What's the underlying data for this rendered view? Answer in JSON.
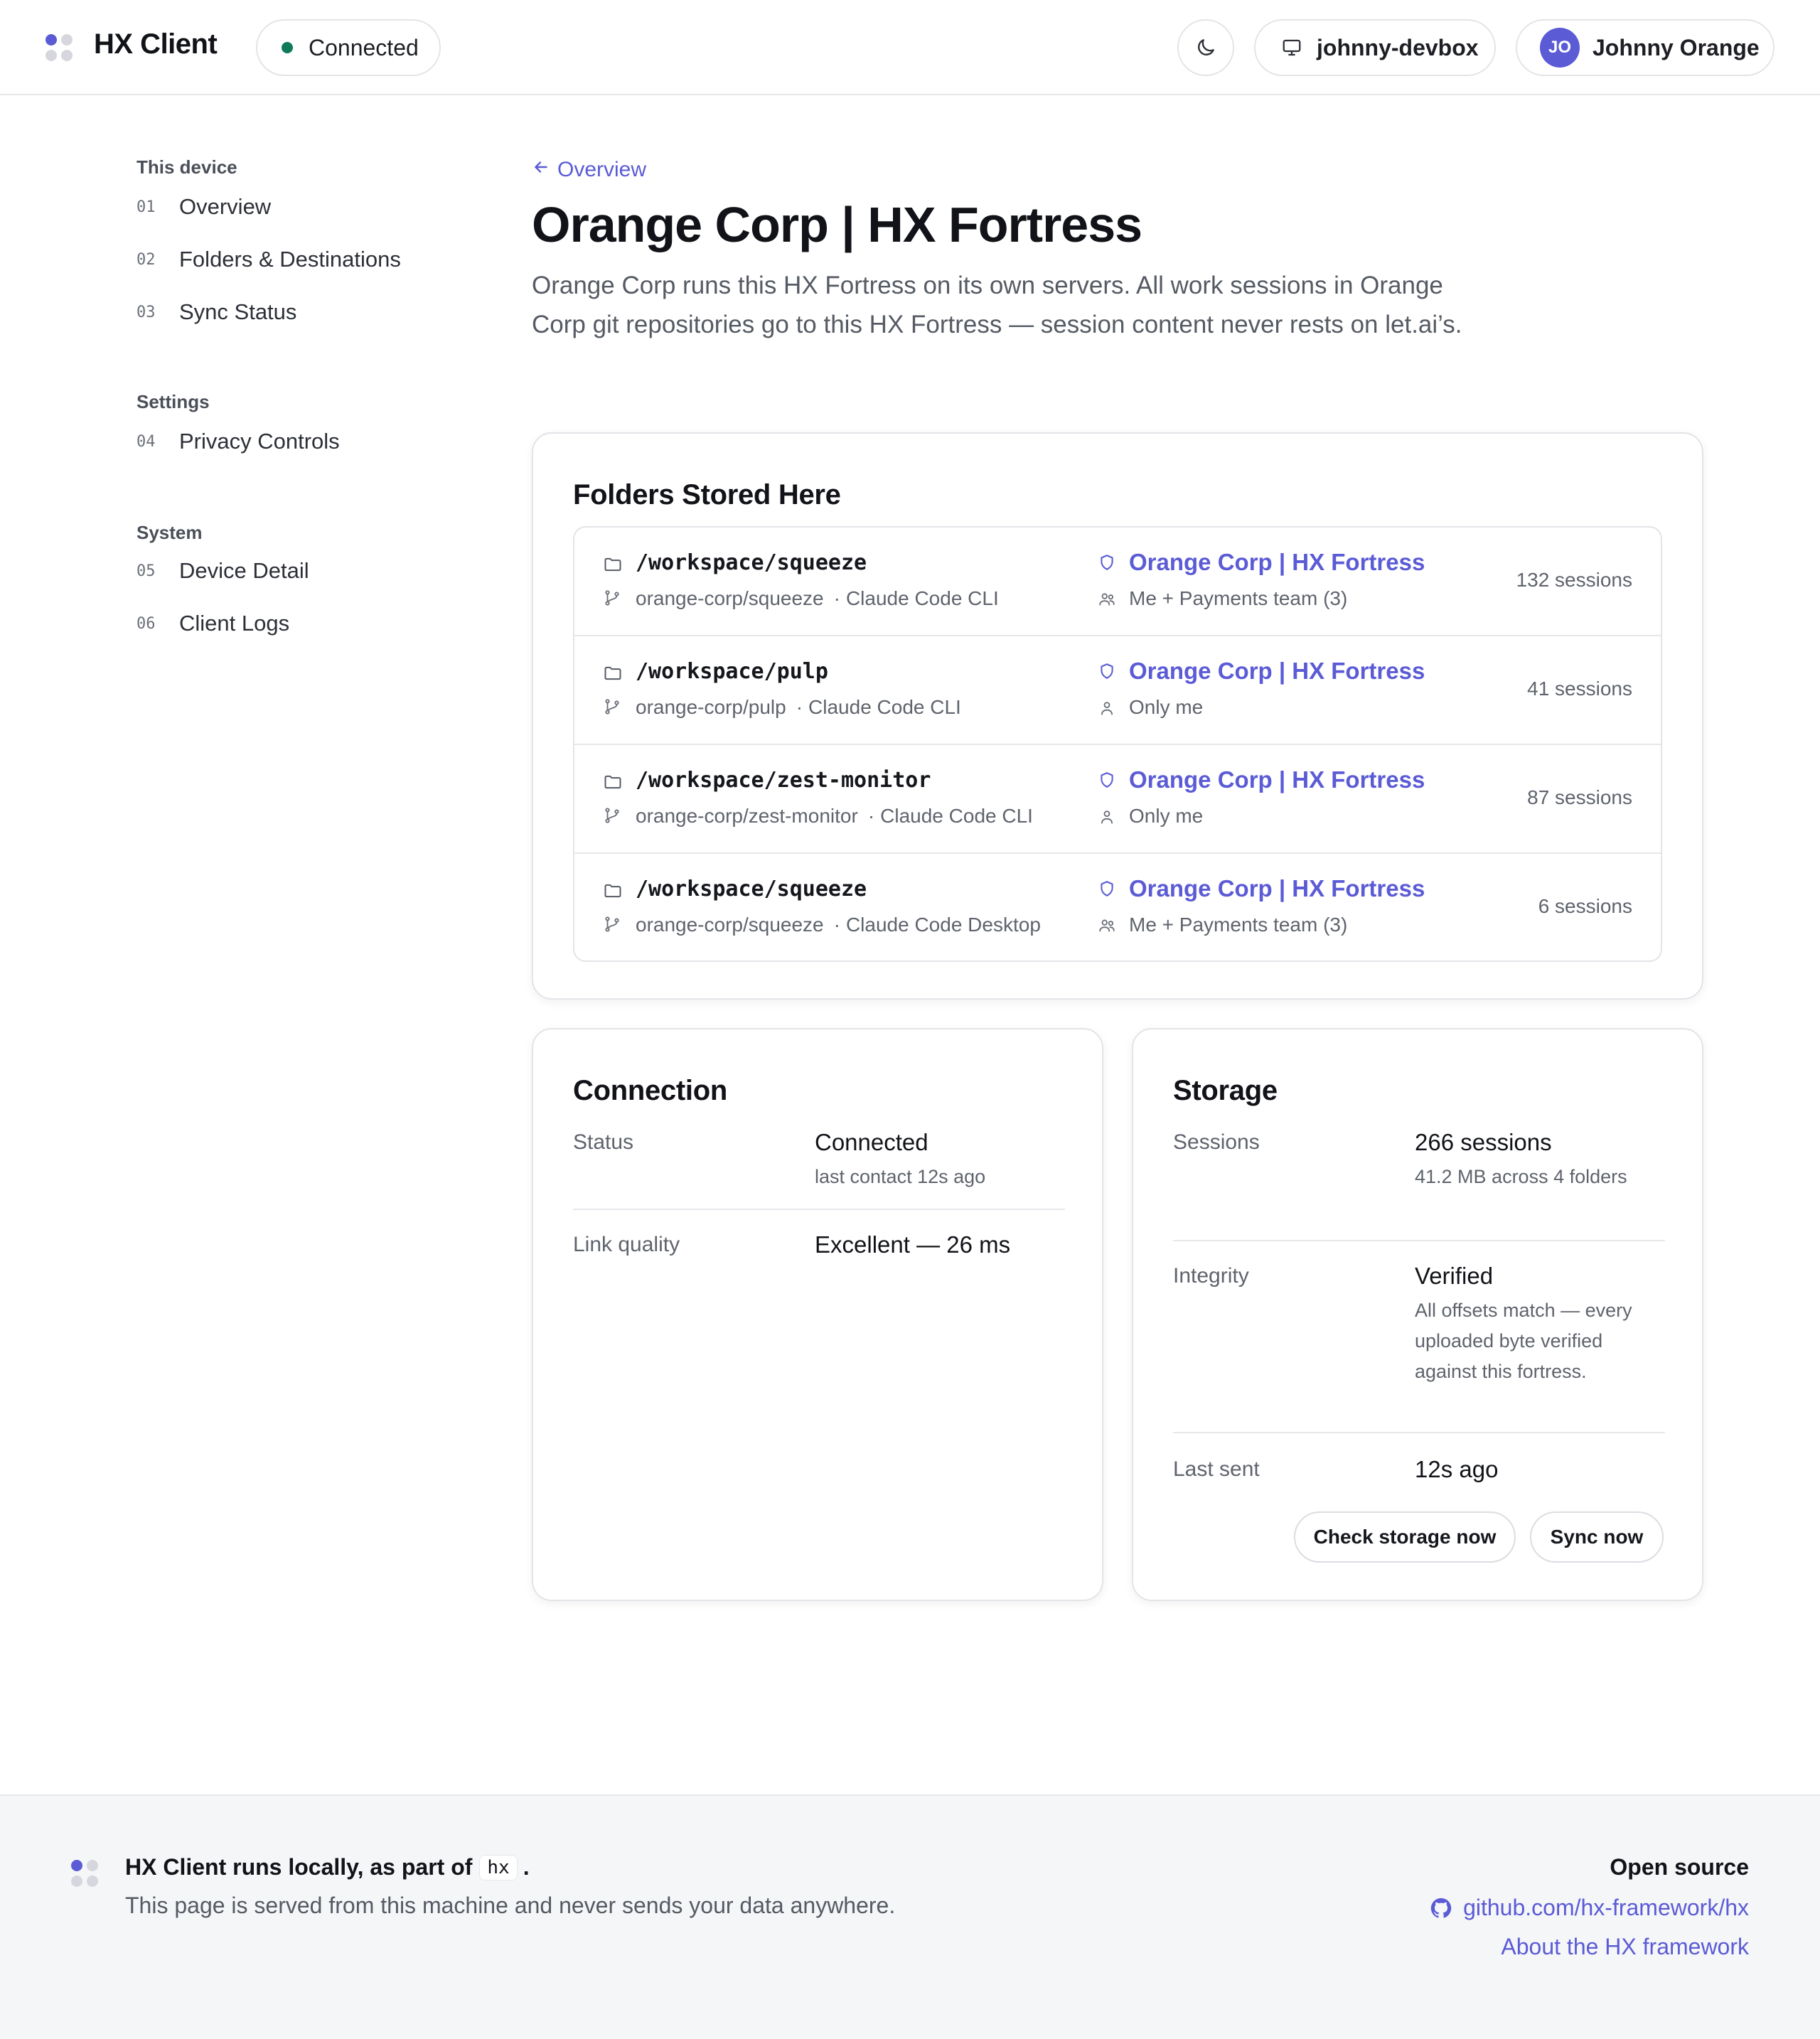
{
  "header": {
    "brand": "HX Client",
    "status": "Connected",
    "device": "johnny-devbox",
    "user_initials": "JO",
    "user_name": "Johnny Orange",
    "accent_color": "#5b5bd6",
    "status_color": "#0f7a5a"
  },
  "sidebar": {
    "sections": [
      {
        "title": "This device",
        "items": [
          {
            "num": "01",
            "label": "Overview"
          },
          {
            "num": "02",
            "label": "Folders & Destinations"
          },
          {
            "num": "03",
            "label": "Sync Status"
          }
        ]
      },
      {
        "title": "Settings",
        "items": [
          {
            "num": "04",
            "label": "Privacy Controls"
          }
        ]
      },
      {
        "title": "System",
        "items": [
          {
            "num": "05",
            "label": "Device Detail"
          },
          {
            "num": "06",
            "label": "Client Logs"
          }
        ]
      }
    ]
  },
  "main": {
    "back_label": "Overview",
    "title": "Orange Corp | HX Fortress",
    "description": "Orange Corp runs this HX Fortress on its own servers. All work sessions in Orange Corp git repositories go to this HX Fortress — session content never rests on let.ai’s."
  },
  "folders": {
    "title": "Folders Stored Here",
    "rows": [
      {
        "path": "/workspace/squeeze",
        "repo": "orange-corp/squeeze",
        "tool": "Claude Code CLI",
        "destination": "Orange Corp | HX Fortress",
        "access": "Me + Payments team (3)",
        "access_icon": "people-icon",
        "sessions": "132 sessions"
      },
      {
        "path": "/workspace/pulp",
        "repo": "orange-corp/pulp",
        "tool": "Claude Code CLI",
        "destination": "Orange Corp | HX Fortress",
        "access": "Only me",
        "access_icon": "person-icon",
        "sessions": "41 sessions"
      },
      {
        "path": "/workspace/zest-monitor",
        "repo": "orange-corp/zest-monitor",
        "tool": "Claude Code CLI",
        "destination": "Orange Corp | HX Fortress",
        "access": "Only me",
        "access_icon": "person-icon",
        "sessions": "87 sessions"
      },
      {
        "path": "/workspace/squeeze",
        "repo": "orange-corp/squeeze",
        "tool": "Claude Code Desktop",
        "destination": "Orange Corp | HX Fortress",
        "access": "Me + Payments team (3)",
        "access_icon": "people-icon",
        "sessions": "6 sessions"
      }
    ]
  },
  "connection": {
    "title": "Connection",
    "status_key": "Status",
    "status_val": "Connected",
    "status_sub": "last contact 12s ago",
    "quality_key": "Link quality",
    "quality_val": "Excellent — 26 ms"
  },
  "storage": {
    "title": "Storage",
    "sessions_key": "Sessions",
    "sessions_val": "266 sessions",
    "sessions_sub": "41.2 MB across 4 folders",
    "integrity_key": "Integrity",
    "integrity_val": "Verified",
    "integrity_sub": "All offsets match — every uploaded byte verified against this fortress.",
    "last_key": "Last sent",
    "last_val": "12s ago",
    "check_btn": "Check storage now",
    "sync_btn": "Sync now"
  },
  "footer": {
    "main_text": "HX Client runs locally, as part of",
    "code": "hx",
    "period": ".",
    "sub_text": "This page is served from this machine and never sends your data anywhere.",
    "open_source_heading": "Open source",
    "github_link": "github.com/hx-framework/hx",
    "about_link": "About the HX framework"
  }
}
